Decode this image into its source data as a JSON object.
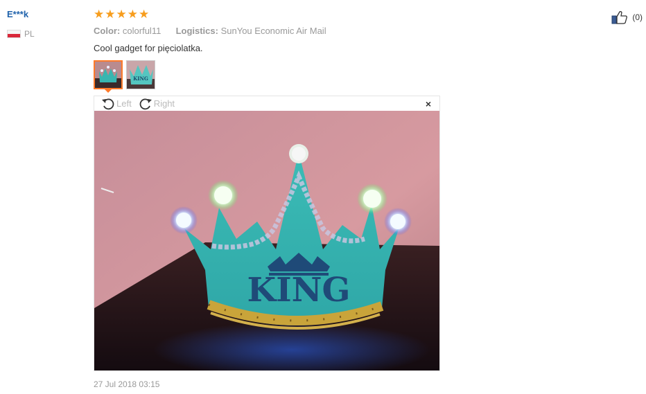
{
  "reviewer": {
    "name": "E***k",
    "country_code": "PL"
  },
  "review": {
    "rating": 5,
    "stars": [
      "★",
      "★",
      "★",
      "★",
      "★"
    ],
    "color_label": "Color:",
    "color_value": "colorful11",
    "logistics_label": "Logistics:",
    "logistics_value": "SunYou Economic Air Mail",
    "text": "Cool gadget for pięciolatka.",
    "date": "27 Jul 2018 03:15"
  },
  "viewer": {
    "rotate_left_label": "Left",
    "rotate_right_label": "Right",
    "close_label": "×"
  },
  "photo": {
    "crown_text": "KING"
  },
  "helpful": {
    "count": "(0)"
  },
  "colors": {
    "star": "#f79d1d",
    "username": "#1f62ab",
    "thumb_active_border": "#ff7a29"
  }
}
